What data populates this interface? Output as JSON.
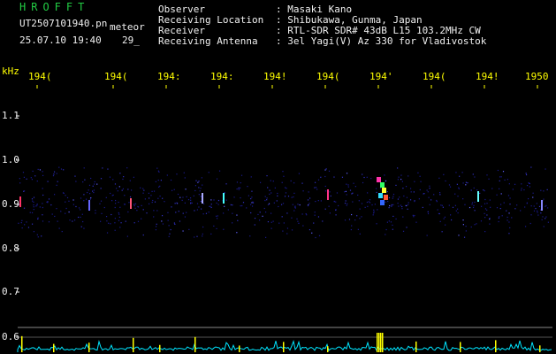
{
  "header": {
    "app_name": "HROFFT",
    "filename": "UT2507101940.pn",
    "meteor_label": "meteor",
    "datetime": "25.07.10 19:40",
    "count": "29_"
  },
  "info": {
    "observer_label": "Observer",
    "observer_value": ": Masaki Kano",
    "location_label": "Receiving Location",
    "location_value": ": Shibukawa, Gunma, Japan",
    "receiver_label": "Receiver",
    "receiver_value": ": RTL-SDR SDR# 43dB L15 103.2MHz CW",
    "antenna_label": "Receiving Antenna",
    "antenna_value": ": 3el Yagi(V) Az 330 for Vladivostok"
  },
  "axis": {
    "unit": "kHz",
    "time_ticks": [
      "194(",
      "194(",
      "194:",
      "194:",
      "194!",
      "194(",
      "194'",
      "194(",
      "194!",
      "1950"
    ],
    "freq_ticks": [
      "1.1",
      "1.0",
      "0.9",
      "0.8",
      "0.7",
      "0.6"
    ]
  },
  "colors": {
    "background": "#000000",
    "title_green": "#22cc44",
    "tick_yellow": "#ffff00",
    "text_white": "#f0f0f0",
    "level_cyan": "#00e5ff",
    "noise_blue": "#1a1a8c"
  }
}
